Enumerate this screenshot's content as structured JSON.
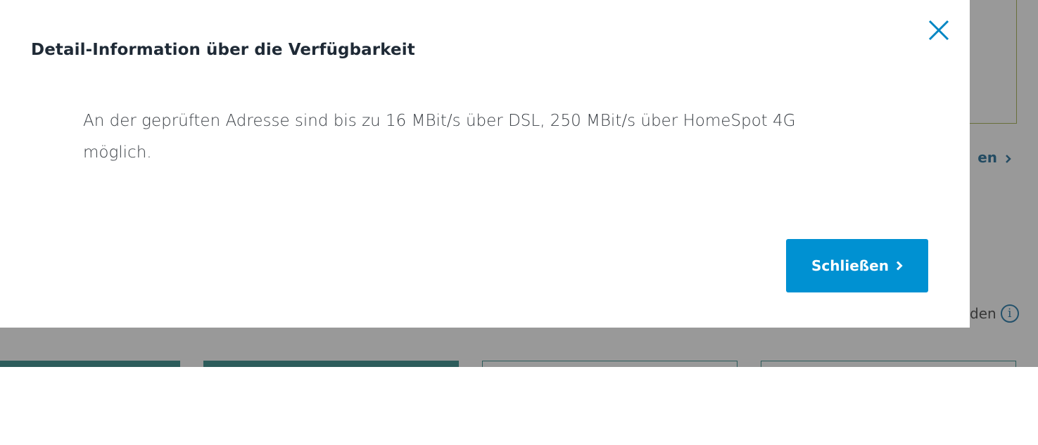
{
  "modal": {
    "title": "Detail-Information über die Verfügbarkeit",
    "body": "An der geprüften Adresse sind bis zu 16 MBit/s über DSL, 250 MBit/s über HomeSpot 4G möglich.",
    "close_button_label": "Schließen",
    "close_icon": "close-icon",
    "button_icon": "chevron-right-icon"
  },
  "background": {
    "link_fragment": "en",
    "info_fragment": "den",
    "info_icon": "info-icon",
    "info_icon_glyph": "i"
  },
  "colors": {
    "accent": "#0091d2",
    "tab": "#1d7f7d",
    "card_border": "#9aaa3a"
  }
}
